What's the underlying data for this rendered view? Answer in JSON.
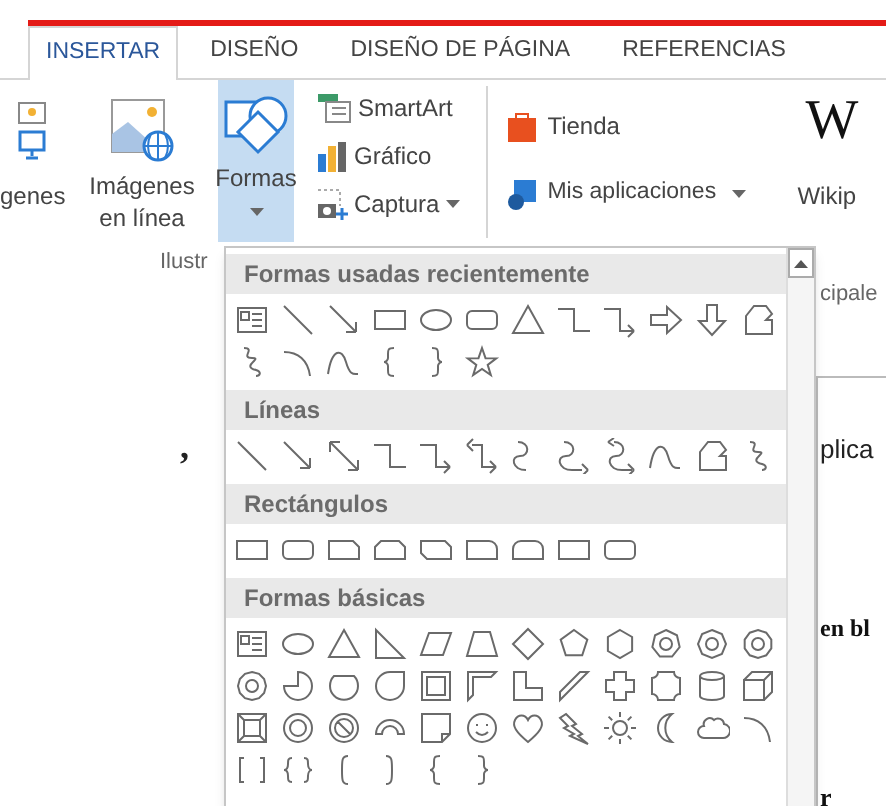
{
  "tabs": [
    {
      "label": "INSERTAR",
      "selected": true
    },
    {
      "label": "DISEÑO",
      "selected": false
    },
    {
      "label": "DISEÑO DE PÁGINA",
      "selected": false
    },
    {
      "label": "REFERENCIAS",
      "selected": false
    }
  ],
  "ribbon": {
    "images": "genes",
    "online_images": "Imágenes en línea",
    "shapes": {
      "label": "Formas",
      "selected": true
    },
    "smartart": "SmartArt",
    "chart": "Gráfico",
    "screenshot": "Captura",
    "store": "Tienda",
    "my_apps": "Mis aplicaciones",
    "word_logo": "W",
    "wikipedia": "Wikip",
    "group_label": "Ilustr"
  },
  "shapes_menu": {
    "sections": [
      {
        "title": "Formas usadas recientemente"
      },
      {
        "title": "Líneas"
      },
      {
        "title": "Rectángulos"
      },
      {
        "title": "Formas básicas"
      }
    ]
  },
  "document": {
    "left_fragment": ",",
    "right_fragments": [
      "cipale",
      "plica",
      "en bl",
      "r"
    ]
  }
}
